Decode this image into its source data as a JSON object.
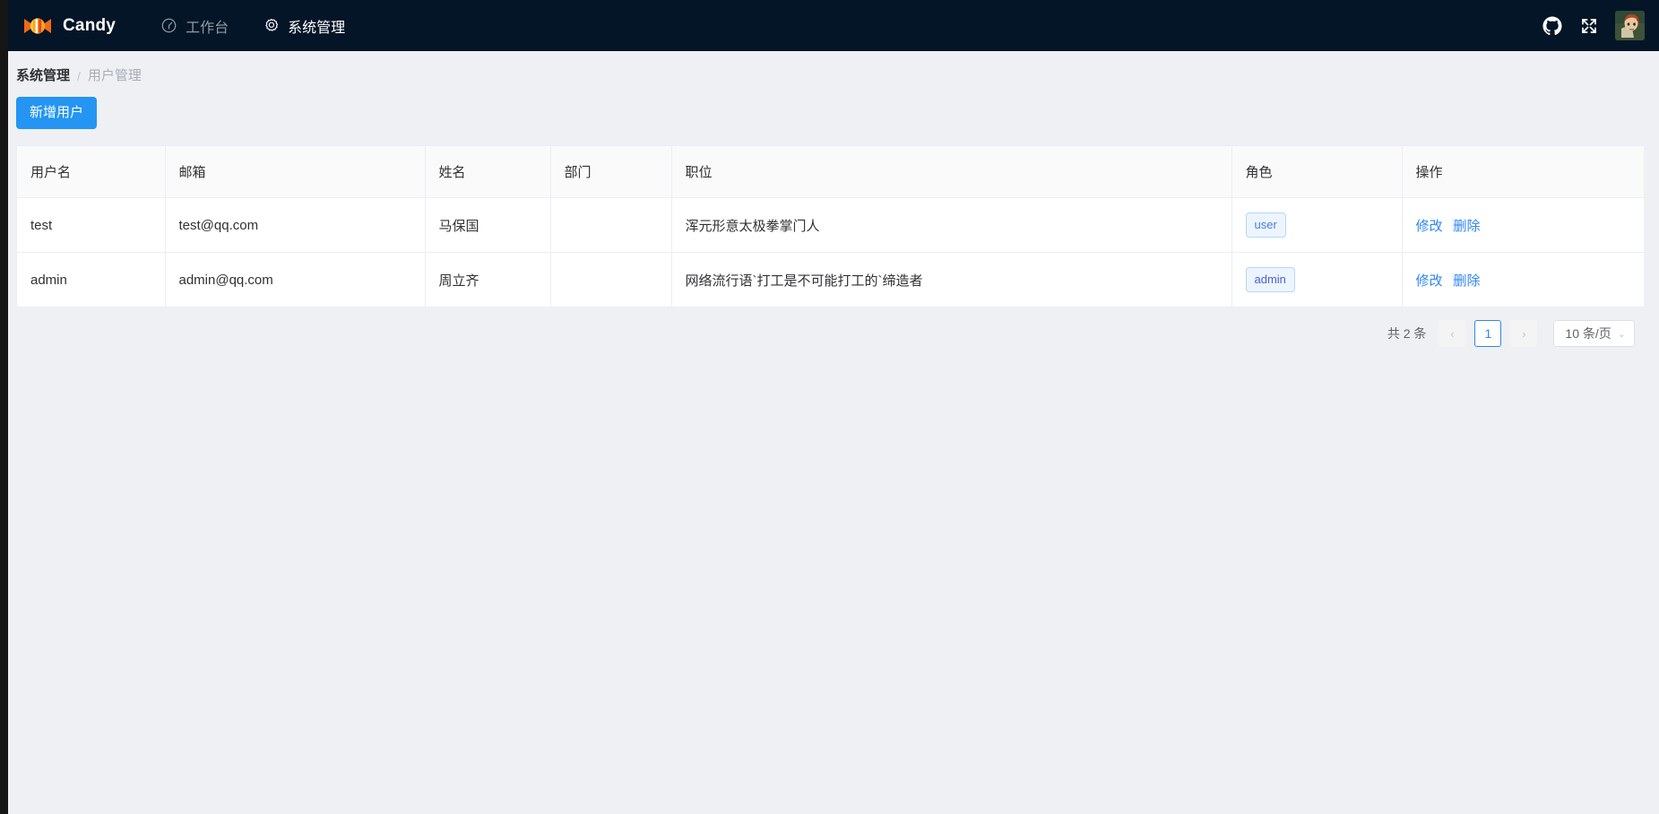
{
  "navbar": {
    "brand": "Candy",
    "logo_icon": "candy-icon",
    "items": [
      {
        "label": "工作台",
        "icon": "dashboard-icon",
        "active": false
      },
      {
        "label": "系统管理",
        "icon": "gear-icon",
        "active": true
      }
    ],
    "right": {
      "github_icon": "github-icon",
      "fullscreen_icon": "fullscreen-icon",
      "avatar_icon": "avatar"
    }
  },
  "breadcrumb": {
    "parent": "系统管理",
    "separator": "/",
    "current": "用户管理"
  },
  "toolbar": {
    "add_user_label": "新增用户"
  },
  "table": {
    "columns": [
      "用户名",
      "邮箱",
      "姓名",
      "部门",
      "职位",
      "角色",
      "操作"
    ],
    "rows": [
      {
        "username": "test",
        "email": "test@qq.com",
        "name": "马保国",
        "department": "",
        "position": "浑元形意太极拳掌门人",
        "role": "user",
        "edit_label": "修改",
        "delete_label": "删除"
      },
      {
        "username": "admin",
        "email": "admin@qq.com",
        "name": "周立齐",
        "department": "",
        "position": "网络流行语`打工是不可能打工的`缔造者",
        "role": "admin",
        "edit_label": "修改",
        "delete_label": "删除"
      }
    ]
  },
  "pagination": {
    "total_text": "共 2 条",
    "prev_glyph": "‹",
    "current_page": "1",
    "next_glyph": "›",
    "page_size_label": "10 条/页",
    "caret_glyph": "⌄"
  },
  "colors": {
    "navbar_bg": "#041527",
    "primary": "#2495f2",
    "link": "#2f86f0",
    "page_bg": "#eef0f4",
    "tag_bg": "#ecf5ff"
  }
}
